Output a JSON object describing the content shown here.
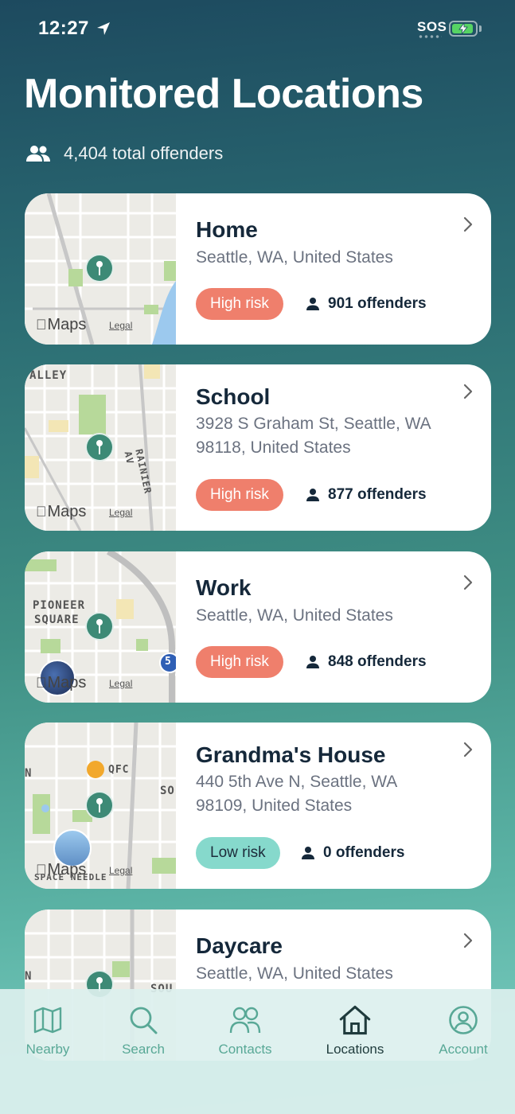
{
  "status_bar": {
    "time": "12:27",
    "sos": "SOS"
  },
  "header": {
    "title": "Monitored Locations",
    "total_offenders": "4,404 total offenders"
  },
  "map_attribution": {
    "maps": "Maps",
    "legal": "Legal"
  },
  "locations": [
    {
      "name": "Home",
      "address": "Seattle, WA, United States",
      "risk": "High risk",
      "offenders": "901 offenders",
      "map_labels": []
    },
    {
      "name": "School",
      "address": "3928 S Graham St, Seattle, WA  98118, United States",
      "risk": "High risk",
      "offenders": "877 offenders",
      "map_labels": [
        "ALLEY",
        "RAINIER AV"
      ]
    },
    {
      "name": "Work",
      "address": "Seattle, WA, United States",
      "risk": "High risk",
      "offenders": "848 offenders",
      "map_labels": [
        "PIONEER",
        "SQUARE",
        "5"
      ]
    },
    {
      "name": "Grandma's House",
      "address": "440 5th Ave N, Seattle, WA 98109, United States",
      "risk": "Low risk",
      "offenders": "0 offenders",
      "map_labels": [
        "QFC",
        "SO",
        "N",
        "SPACE NEEDLE"
      ]
    },
    {
      "name": "Daycare",
      "address": "Seattle, WA, United States",
      "risk": "",
      "offenders": "",
      "map_labels": [
        "SOU"
      ]
    }
  ],
  "tabs": [
    {
      "label": "Nearby",
      "icon": "map-icon",
      "active": false
    },
    {
      "label": "Search",
      "icon": "search-icon",
      "active": false
    },
    {
      "label": "Contacts",
      "icon": "contacts-icon",
      "active": false
    },
    {
      "label": "Locations",
      "icon": "home-icon",
      "active": true
    },
    {
      "label": "Account",
      "icon": "account-icon",
      "active": false
    }
  ],
  "colors": {
    "high_risk": "#ef7f6c",
    "low_risk": "#86d9cc",
    "accent": "#58a896",
    "pin": "#3d8a76"
  }
}
